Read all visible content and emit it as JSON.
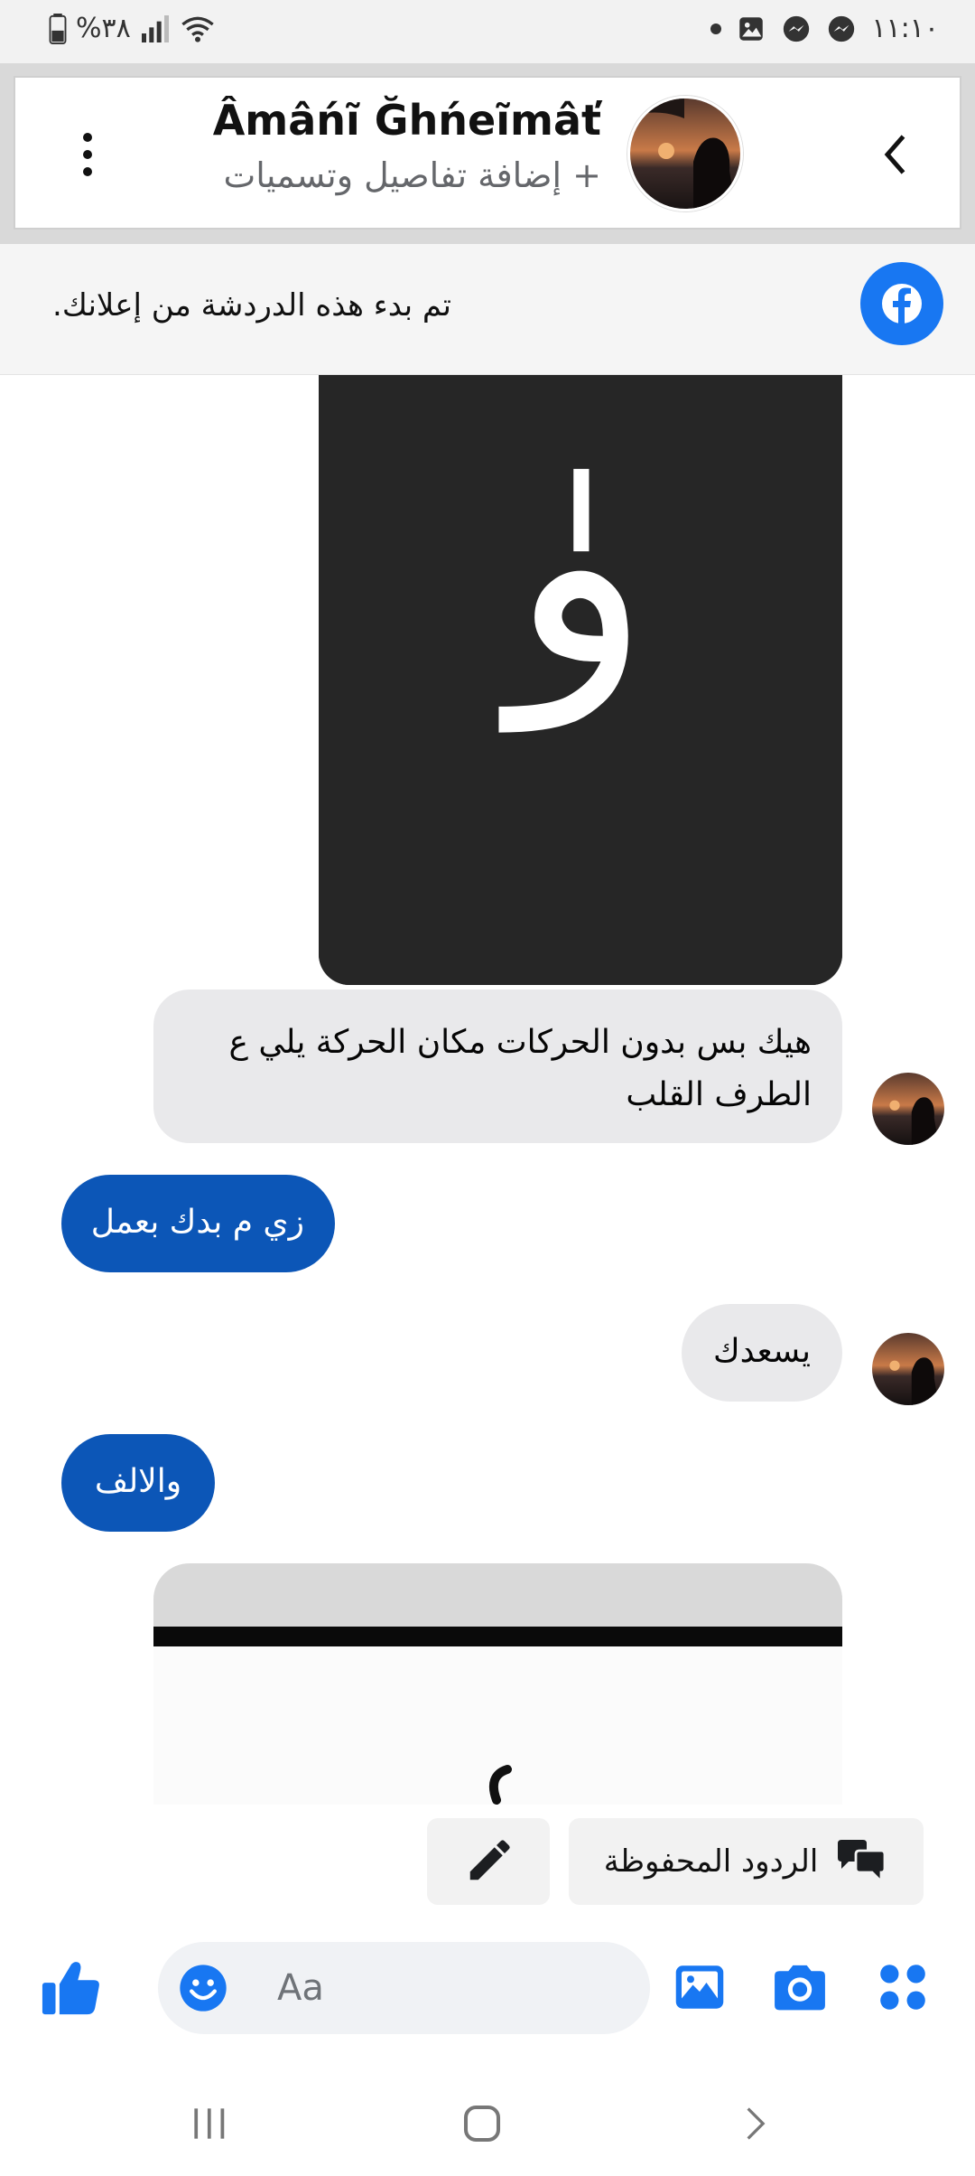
{
  "status_bar": {
    "time": "١١:١٠",
    "battery": "%٣٨"
  },
  "header": {
    "title": "Âmâńĩ Ğhńeĩmâť",
    "subtitle": "+ إضافة تفاصيل وتسميات"
  },
  "ad_banner": {
    "text": ".تم بدء هذه الدردشة من إعلانك"
  },
  "messages": [
    {
      "type": "image",
      "direction": "received",
      "glyph": "وٰ"
    },
    {
      "type": "text",
      "direction": "received",
      "text": "هيك بس بدون الحركات مكان الحركة يلي ع الطرف القلب"
    },
    {
      "type": "text",
      "direction": "sent",
      "text": "زي م بدك بعمل"
    },
    {
      "type": "text",
      "direction": "received",
      "text": "يسعدك"
    },
    {
      "type": "text",
      "direction": "sent",
      "text": "والالف"
    },
    {
      "type": "image",
      "direction": "received"
    }
  ],
  "quick_replies": {
    "saved_label": "الردود المحفوظة"
  },
  "composer": {
    "placeholder": "Aa"
  },
  "colors": {
    "brand_blue": "#1877f2",
    "sent_bubble": "#0c56b7",
    "received_bubble": "#e9e9eb"
  },
  "icons": {
    "apps": "apps-icon",
    "camera": "camera-icon",
    "gallery": "gallery-icon",
    "emoji": "emoji-icon",
    "like": "thumbs-up-icon",
    "saved_replies": "saved-replies-icon",
    "edit": "pencil-icon"
  }
}
